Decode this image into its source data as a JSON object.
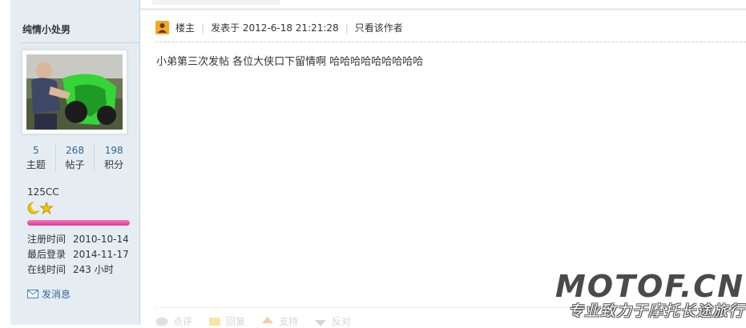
{
  "author": {
    "username": "纯情小处男",
    "avatar_icon": "user-photo-motorcycle",
    "stats": [
      {
        "value": "5",
        "label": "主题"
      },
      {
        "value": "268",
        "label": "帖子"
      },
      {
        "value": "198",
        "label": "积分"
      }
    ],
    "group": "125CC",
    "info": [
      {
        "key": "注册时间",
        "value": "2010-10-14"
      },
      {
        "key": "最后登录",
        "value": "2014-11-17"
      },
      {
        "key": "在线时间",
        "value": "243 小时"
      }
    ],
    "send_message": "发消息"
  },
  "post": {
    "owner_label": "楼主",
    "posted_at": "发表于 2012-6-18 21:21:28",
    "only_author": "只看该作者",
    "content": "小弟第三次发帖  各位大侠口下留情啊  哈哈哈哈哈哈哈哈哈"
  },
  "footer": {
    "actions": [
      "点评",
      "回复",
      "支持",
      "反对"
    ]
  },
  "watermark": {
    "title": "MOTOF.CN",
    "subtitle": "专业致力于摩托长途旅行"
  },
  "colors": {
    "sidebar_bg": "#e5edf2",
    "link": "#336699",
    "level_bar": "#e84aa6",
    "owner_badge": "#f6a623"
  }
}
